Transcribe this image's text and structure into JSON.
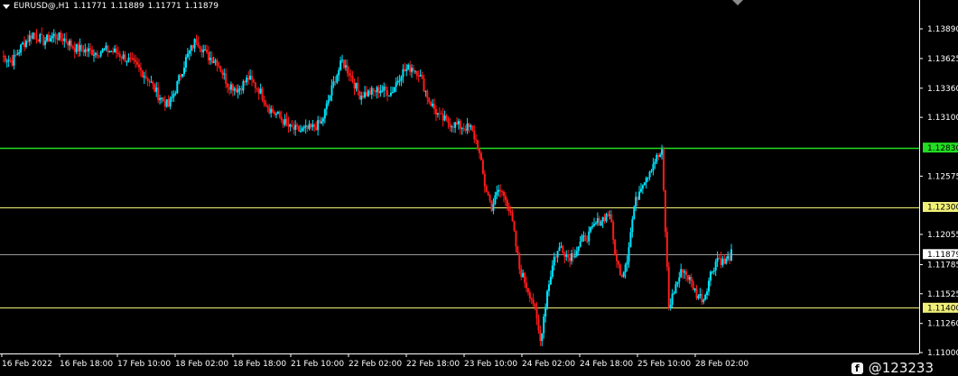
{
  "header": {
    "symbol": "EURUSD@,H1",
    "open": "1.11771",
    "high": "1.11889",
    "low": "1.11771",
    "close": "1.11879"
  },
  "watermark": "@123233",
  "colors": {
    "background": "#000000",
    "bull": "#00e5ff",
    "bear": "#ff1a1a",
    "axis": "#ffffff",
    "green_level": "#22dd22",
    "yellow_level": "#f0f078",
    "price_line": "#9a9a9a"
  },
  "chart_data": {
    "type": "candlestick",
    "timeframe": "H1",
    "ylim": [
      1.1101,
      1.1398
    ],
    "y_ticks": [
      "1.13890",
      "1.13625",
      "1.13360",
      "1.13100",
      "1.12575",
      "1.12055",
      "1.11785",
      "1.11525",
      "1.11260",
      "1.11000"
    ],
    "x_ticks": [
      "16 Feb 2022",
      "16 Feb 18:00",
      "17 Feb 10:00",
      "18 Feb 02:00",
      "18 Feb 18:00",
      "21 Feb 10:00",
      "22 Feb 02:00",
      "22 Feb 18:00",
      "23 Feb 10:00",
      "24 Feb 02:00",
      "24 Feb 18:00",
      "25 Feb 10:00",
      "28 Feb 02:00"
    ],
    "levels": [
      {
        "label": "1.12830",
        "value": 1.1283,
        "color": "#22dd22"
      },
      {
        "label": "1.12300",
        "value": 1.123,
        "color": "#f0f078"
      },
      {
        "label": "1.11400",
        "value": 1.114,
        "color": "#f0f078"
      },
      {
        "label": "1.11879",
        "value": 1.11879,
        "color": "#9a9a9a"
      }
    ],
    "close_path": [
      [
        0,
        1.1365
      ],
      [
        6,
        1.136
      ],
      [
        12,
        1.1375
      ],
      [
        18,
        1.1385
      ],
      [
        24,
        1.1378
      ],
      [
        30,
        1.1383
      ],
      [
        36,
        1.138
      ],
      [
        42,
        1.1372
      ],
      [
        48,
        1.137
      ],
      [
        54,
        1.1368
      ],
      [
        60,
        1.137
      ],
      [
        66,
        1.1368
      ],
      [
        72,
        1.1362
      ],
      [
        78,
        1.1355
      ],
      [
        84,
        1.1345
      ],
      [
        90,
        1.133
      ],
      [
        96,
        1.132
      ],
      [
        100,
        1.1335
      ],
      [
        106,
        1.1362
      ],
      [
        112,
        1.138
      ],
      [
        118,
        1.1365
      ],
      [
        124,
        1.136
      ],
      [
        130,
        1.134
      ],
      [
        136,
        1.1335
      ],
      [
        142,
        1.1345
      ],
      [
        148,
        1.1335
      ],
      [
        154,
        1.1318
      ],
      [
        160,
        1.131
      ],
      [
        166,
        1.13
      ],
      [
        172,
        1.1298
      ],
      [
        178,
        1.13
      ],
      [
        184,
        1.1305
      ],
      [
        188,
        1.1325
      ],
      [
        192,
        1.1345
      ],
      [
        196,
        1.136
      ],
      [
        200,
        1.135
      ],
      [
        206,
        1.133
      ],
      [
        212,
        1.1332
      ],
      [
        218,
        1.1335
      ],
      [
        224,
        1.1332
      ],
      [
        230,
        1.135
      ],
      [
        236,
        1.1355
      ],
      [
        240,
        1.135
      ],
      [
        246,
        1.1325
      ],
      [
        252,
        1.131
      ],
      [
        258,
        1.1305
      ],
      [
        264,
        1.1302
      ],
      [
        270,
        1.13
      ],
      [
        274,
        1.1285
      ],
      [
        278,
        1.125
      ],
      [
        282,
        1.123
      ],
      [
        286,
        1.1245
      ],
      [
        290,
        1.124
      ],
      [
        294,
        1.1215
      ],
      [
        298,
        1.1175
      ],
      [
        302,
        1.116
      ],
      [
        306,
        1.1145
      ],
      [
        310,
        1.111
      ],
      [
        314,
        1.1155
      ],
      [
        318,
        1.1185
      ],
      [
        322,
        1.1195
      ],
      [
        326,
        1.1185
      ],
      [
        330,
        1.119
      ],
      [
        334,
        1.12
      ],
      [
        338,
        1.1205
      ],
      [
        342,
        1.1215
      ],
      [
        346,
        1.122
      ],
      [
        350,
        1.1225
      ],
      [
        352,
        1.12
      ],
      [
        354,
        1.118
      ],
      [
        357,
        1.117
      ],
      [
        360,
        1.1185
      ],
      [
        364,
        1.123
      ],
      [
        368,
        1.125
      ],
      [
        372,
        1.126
      ],
      [
        376,
        1.1272
      ],
      [
        380,
        1.1278
      ],
      [
        384,
        1.114
      ],
      [
        388,
        1.116
      ],
      [
        392,
        1.1175
      ],
      [
        396,
        1.1165
      ],
      [
        400,
        1.1152
      ],
      [
        404,
        1.1148
      ],
      [
        408,
        1.117
      ],
      [
        412,
        1.1185
      ],
      [
        416,
        1.118
      ],
      [
        420,
        1.1188
      ]
    ]
  }
}
